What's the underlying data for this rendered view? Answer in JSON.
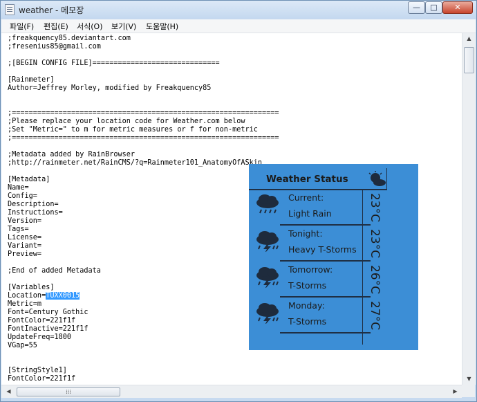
{
  "window": {
    "title": "weather - 메모장",
    "minimize_label": "—",
    "maximize_label": "□",
    "close_label": "✕"
  },
  "menu": [
    "파일(F)",
    "편집(E)",
    "서식(O)",
    "보기(V)",
    "도움말(H)"
  ],
  "editor": {
    "text_before_selection": ";freakquency85.deviantart.com\n;fresenius85@gmail.com\n\n;[BEGIN CONFIG FILE]==============================\n\n[Rainmeter]\nAuthor=Jeffrey Morley, modified by Freakquency85\n\n\n;===============================================================\n;Please replace your location code for Weather.com below\n;Set \"Metric=\" to m for metric measures or f for non-metric\n;===============================================================\n\n;Metadata added by RainBrowser\n;http://rainmeter.net/RainCMS/?q=Rainmeter101_AnatomyOfASkin\n\n[Metadata]\nName=\nConfig=\nDescription=\nInstructions=\nVersion=\nTags=\nLicense=\nVariant=\nPreview=\n\n;End of added Metadata\n\n[Variables]\nLocation=",
    "selected_text": "TUXX0015",
    "text_after_selection": "\nMetric=m\nFont=Century Gothic\nFontColor=221f1f\nFontInactive=221f1f\nUpdateFreq=1800\nVGap=55\n\n\n[StringStyle1]\nFontColor=221f1f"
  },
  "scrollbar": {
    "up_arrow": "▲",
    "down_arrow": "▼",
    "left_arrow": "◀",
    "right_arrow": "▶",
    "grip": "⁞⁞⁞"
  },
  "widget": {
    "title": "Weather Status",
    "rows": [
      {
        "period": "Current:",
        "condition": "Light Rain",
        "temp": "23°C",
        "icon": "rain-cloud-icon"
      },
      {
        "period": "Tonight:",
        "condition": "Heavy T-Storms",
        "temp": "23°C",
        "icon": "thunderstorm-icon"
      },
      {
        "period": "Tomorrow:",
        "condition": "T-Storms",
        "temp": "26°C",
        "icon": "thunderstorm-icon"
      },
      {
        "period": "Monday:",
        "condition": "T-Storms",
        "temp": "27°C",
        "icon": "thunderstorm-icon"
      }
    ],
    "colors": {
      "background": "#3c8ed6",
      "text": "#1b1b1b",
      "lines": "#1f2f44"
    }
  }
}
